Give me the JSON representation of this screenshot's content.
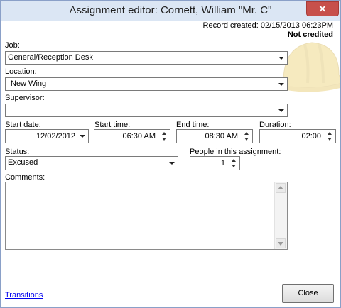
{
  "window": {
    "title": "Assignment editor: Cornett, William \"Mr. C\"",
    "close_glyph": "✕"
  },
  "record": {
    "created": "Record created: 02/15/2013 06:23PM",
    "credit_status": "Not credited"
  },
  "job": {
    "label": "Job:",
    "value": "General/Reception Desk"
  },
  "location": {
    "label": "Location:",
    "value": "New Wing"
  },
  "supervisor": {
    "label": "Supervisor:",
    "value": ""
  },
  "start_date": {
    "label": "Start date:",
    "value": "12/02/2012"
  },
  "start_time": {
    "label": "Start time:",
    "value": "06:30 AM"
  },
  "end_time": {
    "label": "End time:",
    "value": "08:30 AM"
  },
  "duration": {
    "label": "Duration:",
    "value": "02:00"
  },
  "status": {
    "label": "Status:",
    "value": "Excused"
  },
  "people": {
    "label": "People in this assignment:",
    "value": "1"
  },
  "comments": {
    "label": "Comments:",
    "value": ""
  },
  "footer": {
    "transitions_link": "Transitions",
    "close_button": "Close"
  },
  "decor": {
    "watermark_icon": "hard-hat-icon",
    "accent_close": "#c7504b",
    "titlebar_bg": "#dbe6f4"
  }
}
